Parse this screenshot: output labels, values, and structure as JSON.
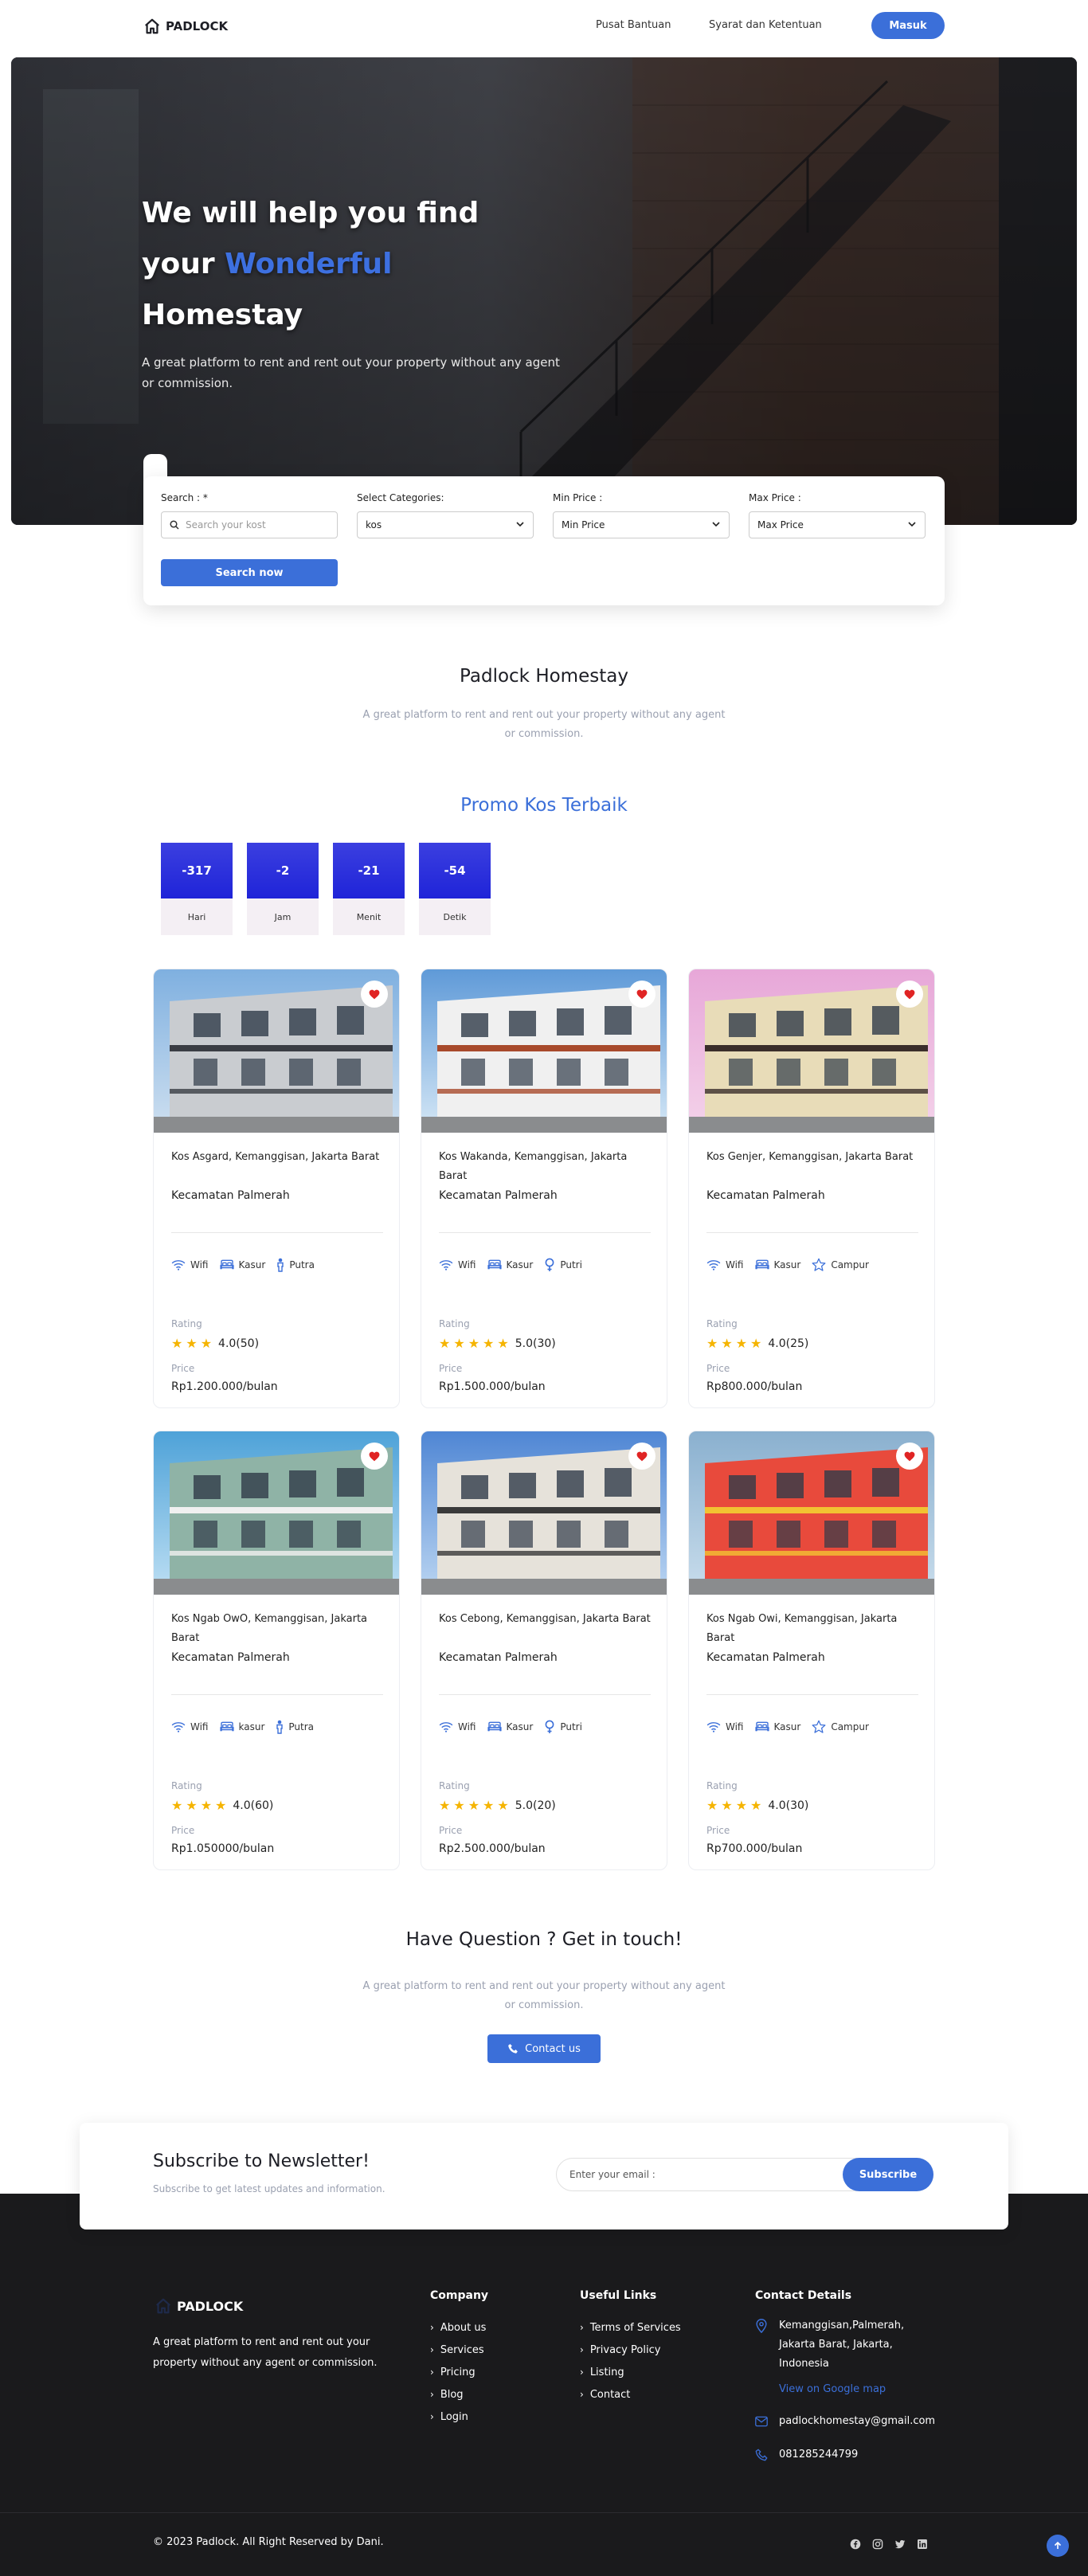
{
  "nav": {
    "brand": "PADLOCK",
    "links": [
      "Pusat Bantuan",
      "Syarat dan Ketentuan"
    ],
    "login": "Masuk"
  },
  "hero": {
    "line1": "We will help you find",
    "line2a": "your ",
    "line2b": "Wonderful",
    "line3": "Homestay",
    "subtitle": "A great platform to rent and rent out your property without any agent or commission."
  },
  "search": {
    "search_label": "Search : *",
    "search_placeholder": "Search your kost",
    "cat_label": "Select Categories:",
    "cat_value": "kos",
    "min_label": "Min Price :",
    "min_value": "Min Price",
    "max_label": "Max Price :",
    "max_value": "Max Price",
    "button": "Search now"
  },
  "about": {
    "title": "Padlock Homestay",
    "subtitle": "A great platform to rent and rent out your property without any agent or commission."
  },
  "promo": {
    "title": "Promo Kos Terbaik",
    "countdown": [
      {
        "value": "-317",
        "label": "Hari"
      },
      {
        "value": "-2",
        "label": "Jam"
      },
      {
        "value": "-21",
        "label": "Menit"
      },
      {
        "value": "-54",
        "label": "Detik"
      }
    ]
  },
  "listings": [
    {
      "address": "Kos Asgard, Kemanggisan, Jakarta Barat",
      "district": "Kecamatan Palmerah",
      "f1": "Wifi",
      "f2": "Kasur",
      "f3": "Putra",
      "g": "male",
      "rating_label": "Rating",
      "stars": 3,
      "rating": "4.0(50)",
      "price_label": "Price",
      "price": "Rp1.200.000/bulan"
    },
    {
      "address": "Kos Wakanda, Kemanggisan, Jakarta Barat",
      "district": "Kecamatan Palmerah",
      "f1": "Wifi",
      "f2": "Kasur",
      "f3": "Putri",
      "g": "female",
      "rating_label": "Rating",
      "stars": 5,
      "rating": "5.0(30)",
      "price_label": "Price",
      "price": "Rp1.500.000/bulan"
    },
    {
      "address": "Kos Genjer, Kemanggisan, Jakarta Barat",
      "district": "Kecamatan Palmerah",
      "f1": "Wifi",
      "f2": "Kasur",
      "f3": "Campur",
      "g": "mixed",
      "rating_label": "Rating",
      "stars": 4,
      "rating": "4.0(25)",
      "price_label": "Price",
      "price": "Rp800.000/bulan"
    },
    {
      "address": "Kos Ngab OwO, Kemanggisan, Jakarta Barat",
      "district": "Kecamatan Palmerah",
      "f1": "Wifi",
      "f2": "kasur",
      "f3": "Putra",
      "g": "male",
      "rating_label": "Rating",
      "stars": 4,
      "rating": "4.0(60)",
      "price_label": "Price",
      "price": "Rp1.050000/bulan"
    },
    {
      "address": "Kos Cebong, Kemanggisan, Jakarta Barat",
      "district": "Kecamatan Palmerah",
      "f1": "Wifi",
      "f2": "Kasur",
      "f3": "Putri",
      "g": "female",
      "rating_label": "Rating",
      "stars": 5,
      "rating": "5.0(20)",
      "price_label": "Price",
      "price": "Rp2.500.000/bulan"
    },
    {
      "address": "Kos Ngab Owi, Kemanggisan, Jakarta Barat",
      "district": "Kecamatan Palmerah",
      "f1": "Wifi",
      "f2": "Kasur",
      "f3": "Campur",
      "g": "mixed",
      "rating_label": "Rating",
      "stars": 4,
      "rating": "4.0(30)",
      "price_label": "Price",
      "price": "Rp700.000/bulan"
    }
  ],
  "question": {
    "title": "Have Question ? Get in touch!",
    "subtitle": "A great platform to rent and rent out your property without any agent or commission.",
    "button": "Contact us"
  },
  "newsletter": {
    "title": "Subscribe to Newsletter!",
    "subtitle": "Subscribe to get latest updates and information.",
    "placeholder": "Enter your email :",
    "button": "Subscribe"
  },
  "footer": {
    "brand": "PADLOCK",
    "desc": "A great platform to rent and rent out your property without any agent or commission.",
    "company_title": "Company",
    "company": [
      "About us",
      "Services",
      "Pricing",
      "Blog",
      "Login"
    ],
    "links_title": "Useful Links",
    "links": [
      "Terms of Services",
      "Privacy Policy",
      "Listing",
      "Contact"
    ],
    "contact_title": "Contact Details",
    "address": "Kemanggisan,Palmerah, Jakarta Barat, Jakarta, Indonesia",
    "map": "View on Google map",
    "email": "padlockhomestay@gmail.com",
    "phone": "081285244799",
    "copyright": "© 2023 Padlock. All Right Reserved by Dani."
  },
  "colors": {
    "accent": "#3b6fd9",
    "footer_bg": "#1a1a1c",
    "star": "#f5b400",
    "heart": "#e02424"
  }
}
